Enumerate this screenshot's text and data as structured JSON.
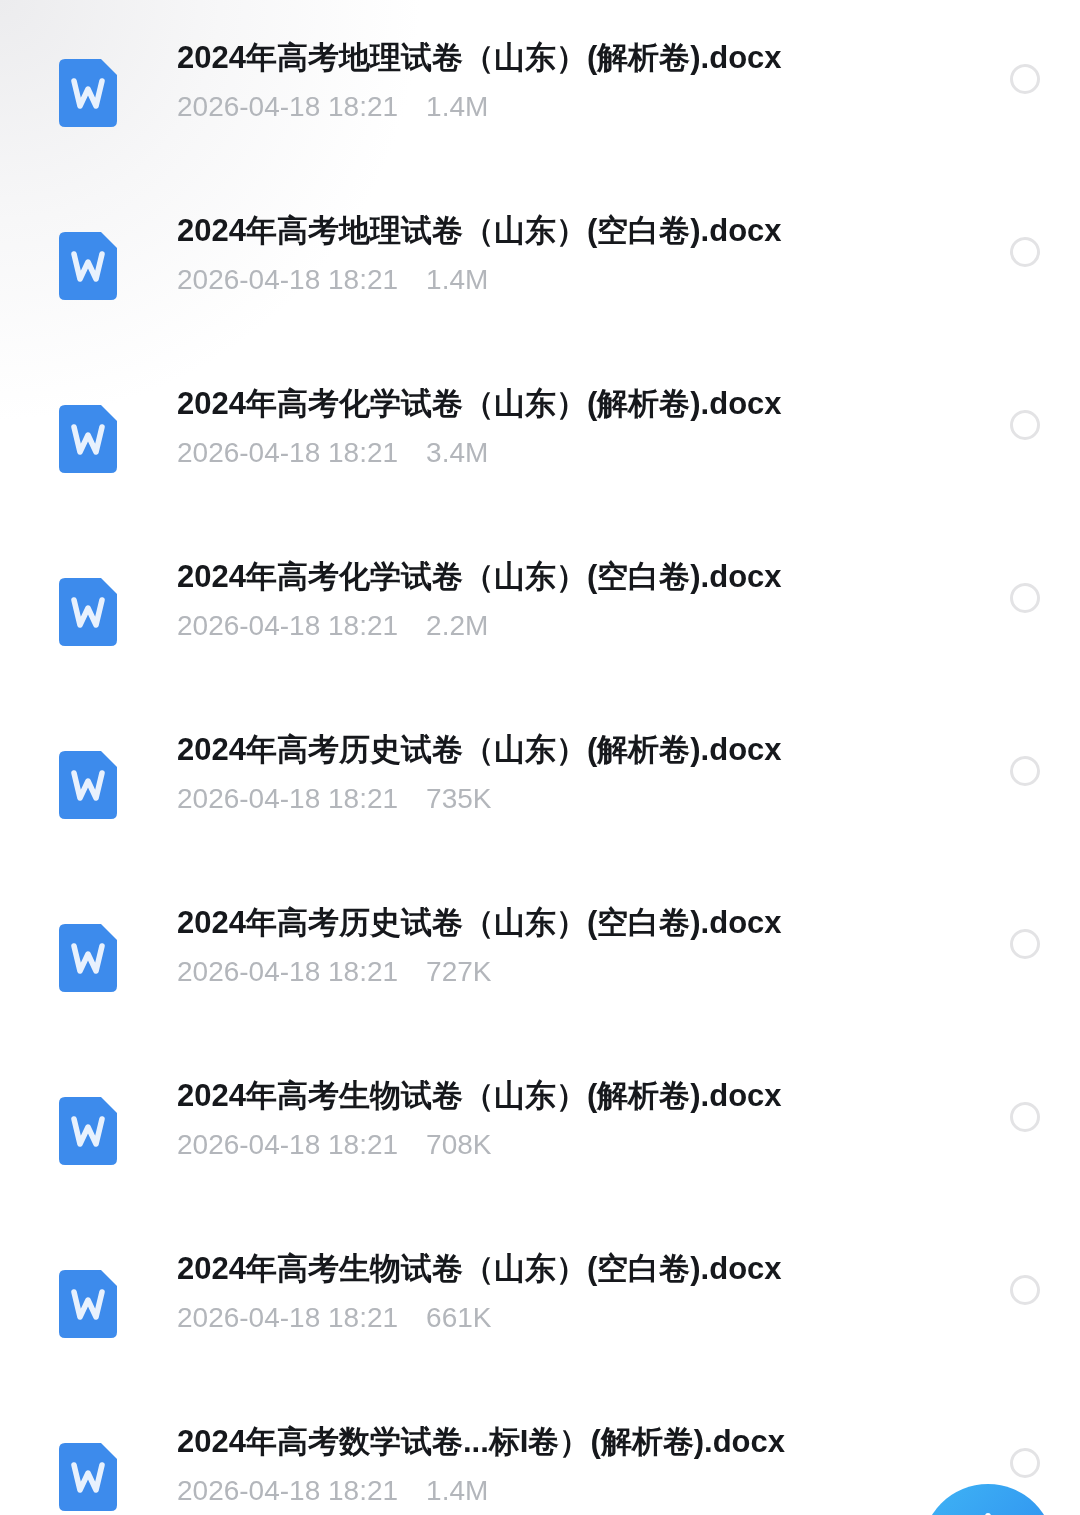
{
  "files": [
    {
      "name": "2024年高考地理试卷（山东）(解析卷).docx",
      "date": "2026-04-18 18:21",
      "size": "1.4M",
      "selected": false
    },
    {
      "name": "2024年高考地理试卷（山东）(空白卷).docx",
      "date": "2026-04-18 18:21",
      "size": "1.4M",
      "selected": false
    },
    {
      "name": "2024年高考化学试卷（山东）(解析卷).docx",
      "date": "2026-04-18 18:21",
      "size": "3.4M",
      "selected": false
    },
    {
      "name": "2024年高考化学试卷（山东）(空白卷).docx",
      "date": "2026-04-18 18:21",
      "size": "2.2M",
      "selected": false
    },
    {
      "name": "2024年高考历史试卷（山东）(解析卷).docx",
      "date": "2026-04-18 18:21",
      "size": "735K",
      "selected": false
    },
    {
      "name": "2024年高考历史试卷（山东）(空白卷).docx",
      "date": "2026-04-18 18:21",
      "size": "727K",
      "selected": false
    },
    {
      "name": "2024年高考生物试卷（山东）(解析卷).docx",
      "date": "2026-04-18 18:21",
      "size": "708K",
      "selected": false
    },
    {
      "name": "2024年高考生物试卷（山东）(空白卷).docx",
      "date": "2026-04-18 18:21",
      "size": "661K",
      "selected": false
    },
    {
      "name": "2024年高考数学试卷...标I卷）(解析卷).docx",
      "date": "2026-04-18 18:21",
      "size": "1.4M",
      "selected": false
    }
  ]
}
